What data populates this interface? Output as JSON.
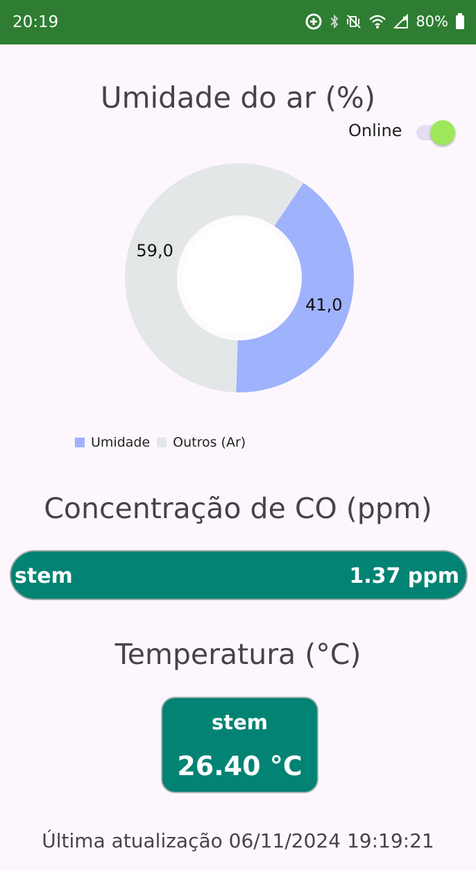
{
  "status_bar": {
    "time": "20:19",
    "battery_percent": "80%",
    "icons": [
      "data-saver-icon",
      "bluetooth-icon",
      "vibrate-mute-icon",
      "wifi-icon",
      "signal-icon",
      "battery-icon"
    ],
    "background_color": "#2e7d32"
  },
  "humidity": {
    "title": "Umidade do ar (%)",
    "online_label": "Online",
    "online_on": true
  },
  "chart_data": {
    "type": "pie",
    "variant": "donut",
    "slices": [
      {
        "name": "Umidade",
        "value": 41.0,
        "label": "41,0",
        "color": "#9fb2fc"
      },
      {
        "name": "Outros (Ar)",
        "value": 59.0,
        "label": "59,0",
        "color": "#e4e7e8"
      }
    ],
    "legend": [
      "Umidade",
      "Outros (Ar)"
    ],
    "legend_position": "bottom-left"
  },
  "co": {
    "title": "Concentração de CO (ppm)",
    "bar_left_text": "stem",
    "bar_value": "1.37 ppm",
    "color": "#028373"
  },
  "temperature": {
    "title": "Temperatura (°C)",
    "card_label": "stem",
    "card_value": "26.40 °C",
    "color": "#028373"
  },
  "footer": {
    "last_update": "Última atualização 06/11/2024 19:19:21"
  }
}
